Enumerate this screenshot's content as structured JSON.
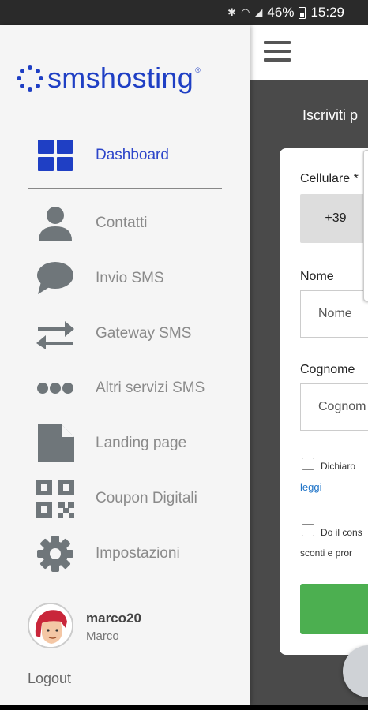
{
  "status_bar": {
    "battery": "46%",
    "time": "15:29"
  },
  "drawer": {
    "logo_text": "smshosting",
    "logo_reg": "®",
    "menu": [
      {
        "label": "Dashboard",
        "icon": "dashboard-icon",
        "active": true
      },
      {
        "label": "Contatti",
        "icon": "contacts-icon"
      },
      {
        "label": "Invio SMS",
        "icon": "chat-bubble-icon"
      },
      {
        "label": "Gateway SMS",
        "icon": "exchange-arrows-icon"
      },
      {
        "label": "Altri servizi SMS",
        "icon": "more-dots-icon"
      },
      {
        "label": "Landing page",
        "icon": "document-icon"
      },
      {
        "label": "Coupon Digitali",
        "icon": "qr-code-icon"
      },
      {
        "label": "Impostazioni",
        "icon": "gear-icon"
      }
    ],
    "user": {
      "username": "marco20",
      "name": "Marco"
    },
    "logout": "Logout"
  },
  "app": {
    "signup_title": "Iscriviti p",
    "form": {
      "cellulare_label": "Cellulare *",
      "prefix": "+39",
      "nome_label": "Nome",
      "nome_placeholder": "Nome",
      "cognome_label": "Cognome",
      "cognome_placeholder": "Cognom",
      "check1_text": "Dichiaro",
      "check1_link": "leggi",
      "check2_text": "Do il cons",
      "check2_subtext": "sconti e pror"
    }
  },
  "colors": {
    "brand": "#1f3fc4",
    "submit": "#4caf50"
  }
}
